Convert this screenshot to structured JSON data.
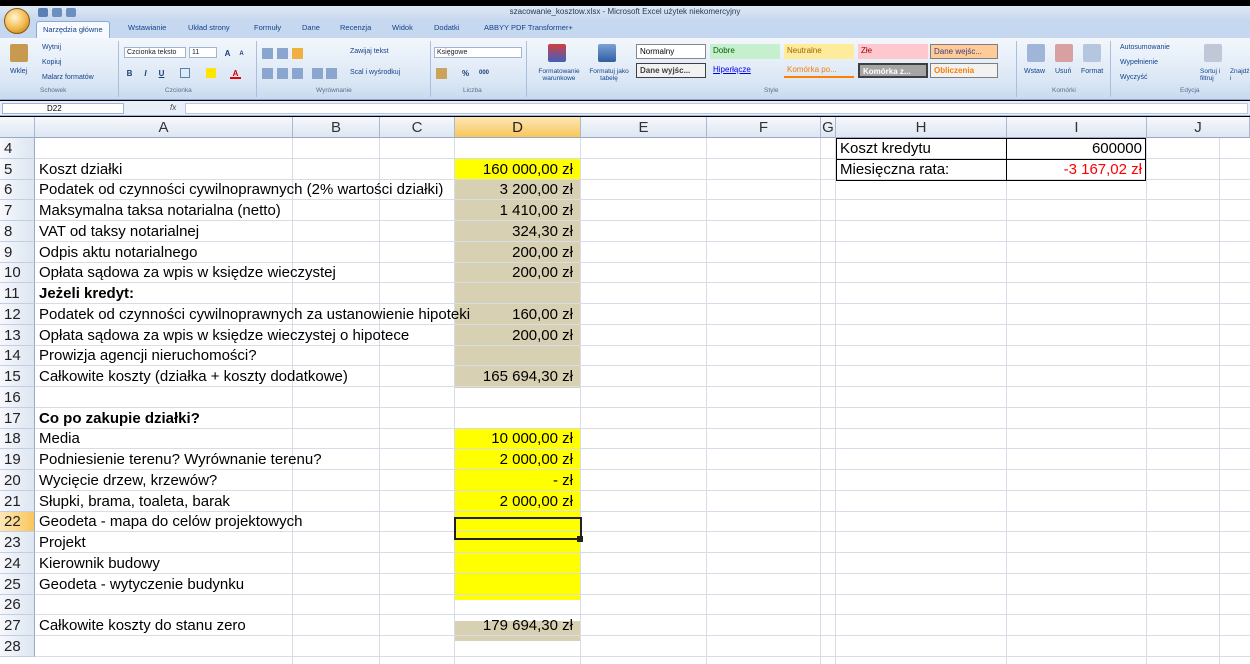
{
  "window": {
    "title": "szacowanie_kosztow.xlsx - Microsoft Excel użytek niekomercyjny"
  },
  "tabs": [
    "Narzędzia główne",
    "Wstawianie",
    "Układ strony",
    "Formuły",
    "Dane",
    "Recenzja",
    "Widok",
    "Dodatki",
    "ABBYY PDF Transformer+"
  ],
  "ribbon": {
    "clipboard": {
      "paste": "Wklej",
      "cut": "Wytnij",
      "copy": "Kopiuj",
      "format_painter": "Malarz formatów",
      "group": "Schowek"
    },
    "font": {
      "name": "Czcionka teksto",
      "size": "11",
      "grow": "A",
      "shrink": "A",
      "bold": "B",
      "italic": "I",
      "underline": "U",
      "font_color": "A",
      "group": "Czcionka"
    },
    "alignment": {
      "wrap": "Zawijaj tekst",
      "merge": "Scal i wyśrodkuj",
      "group": "Wyrównanie"
    },
    "number": {
      "format": "Księgowe",
      "percent": "%",
      "thousands": "000",
      "group": "Liczba"
    },
    "styles": {
      "cond": "Formatowanie warunkowe",
      "table": "Formatuj jako tabelę",
      "items": [
        "Normalny",
        "Dobre",
        "Neutralne",
        "Złe",
        "Dane wejśc...",
        "Dane wyjśc...",
        "Hiperłącze",
        "Komórka po...",
        "Komórka z...",
        "Obliczenia"
      ],
      "group": "Style"
    },
    "cells": {
      "insert": "Wstaw",
      "delete": "Usuń",
      "format": "Format",
      "group": "Komórki"
    },
    "editing": {
      "autosum": "Autosumowanie",
      "fill": "Wypełnienie",
      "clear": "Wyczyść",
      "sort": "Sortuj i filtruj",
      "find": "Znajdź i zaznacz",
      "group": "Edycja"
    }
  },
  "formula_bar": {
    "name_box": "D22",
    "fx": "fx",
    "value": ""
  },
  "columns": [
    "A",
    "B",
    "C",
    "D",
    "E",
    "F",
    "G",
    "H",
    "I",
    "J"
  ],
  "rows": [
    {
      "n": "4",
      "a": "",
      "d": "",
      "bold": false
    },
    {
      "n": "5",
      "a": "Koszt działki",
      "d": "160 000,00 zł",
      "bold": false
    },
    {
      "n": "6",
      "a": "Podatek od czynności cywilnoprawnych (2% wartości działki)",
      "d": "3 200,00 zł",
      "bold": false
    },
    {
      "n": "7",
      "a": "Maksymalna taksa notarialna (netto)",
      "d": "1 410,00 zł",
      "bold": false
    },
    {
      "n": "8",
      "a": "VAT od taksy notarialnej",
      "d": "324,30 zł",
      "bold": false
    },
    {
      "n": "9",
      "a": "Odpis aktu notarialnego",
      "d": "200,00 zł",
      "bold": false
    },
    {
      "n": "10",
      "a": "Opłata sądowa za wpis w księdze wieczystej",
      "d": "200,00 zł",
      "bold": false
    },
    {
      "n": "11",
      "a": "Jeżeli kredyt:",
      "d": "",
      "bold": true
    },
    {
      "n": "12",
      "a": "Podatek od czynności cywilnoprawnych za ustanowienie hipoteki",
      "d": "160,00 zł",
      "bold": false
    },
    {
      "n": "13",
      "a": "Opłata sądowa za wpis w księdze wieczystej o hipotece",
      "d": "200,00 zł",
      "bold": false
    },
    {
      "n": "14",
      "a": "Prowizja agencji nieruchomości?",
      "d": "",
      "bold": false
    },
    {
      "n": "15",
      "a": "Całkowite koszty (działka + koszty dodatkowe)",
      "d": "165 694,30 zł",
      "bold": false
    },
    {
      "n": "16",
      "a": "",
      "d": "",
      "bold": false
    },
    {
      "n": "17",
      "a": "Co po zakupie działki?",
      "d": "",
      "bold": true
    },
    {
      "n": "18",
      "a": "Media",
      "d": "10 000,00 zł",
      "bold": false
    },
    {
      "n": "19",
      "a": "Podniesienie terenu? Wyrównanie terenu?",
      "d": "2 000,00 zł",
      "bold": false
    },
    {
      "n": "20",
      "a": "Wycięcie drzew, krzewów?",
      "d": "-    zł",
      "bold": false
    },
    {
      "n": "21",
      "a": "Słupki, brama, toaleta, barak",
      "d": "2 000,00 zł",
      "bold": false
    },
    {
      "n": "22",
      "a": "Geodeta - mapa do celów projektowych",
      "d": "",
      "bold": false
    },
    {
      "n": "23",
      "a": "Projekt",
      "d": "",
      "bold": false
    },
    {
      "n": "24",
      "a": "Kierownik budowy",
      "d": "",
      "bold": false
    },
    {
      "n": "25",
      "a": "Geodeta - wytyczenie budynku",
      "d": "",
      "bold": false
    },
    {
      "n": "26",
      "a": "",
      "d": "",
      "bold": false
    },
    {
      "n": "27",
      "a": "Całkowite koszty do stanu zero",
      "d": "179 694,30 zł",
      "bold": false
    },
    {
      "n": "28",
      "a": "",
      "d": "",
      "bold": false
    }
  ],
  "side": {
    "h5": "Koszt kredytu",
    "i5": "600000",
    "h6": "Miesięczna rata:",
    "i6": "-3 167,02 zł"
  },
  "colors": {
    "yellow": "#ffff00",
    "tan": "#d8d0b2",
    "red": "#ff0000"
  }
}
